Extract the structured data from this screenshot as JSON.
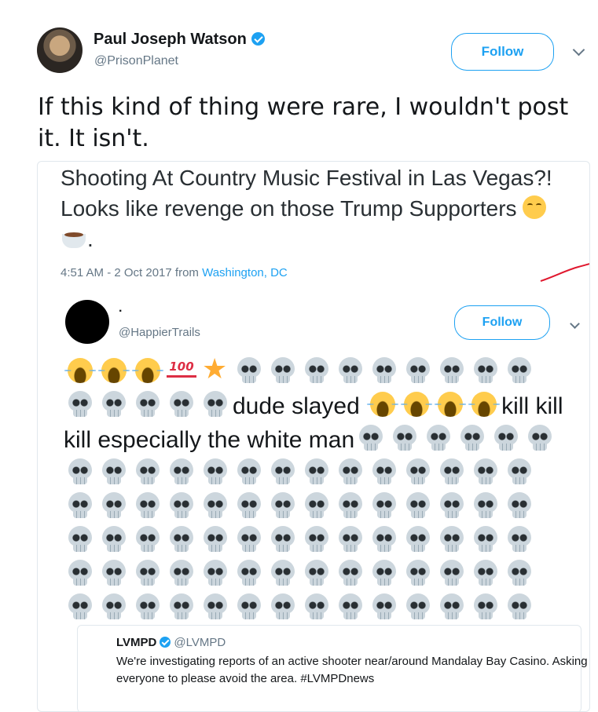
{
  "tweet": {
    "author_name": "Paul Joseph Watson",
    "author_handle": "@PrisonPlanet",
    "follow_label": "Follow",
    "text": "If this kind of thing were rare, I wouldn't post it. It isn't."
  },
  "embedded_screenshot": {
    "text": "Shooting At Country Music Festival in Las Vegas?! Looks like revenge on those Trump Supporters",
    "text_end": ".",
    "meta_time": "4:51 AM - 2 Oct 2017 from ",
    "meta_location": "Washington, DC",
    "emojis": [
      "relieved-face",
      "hot-beverage"
    ],
    "inner_tweet": {
      "author_name": ".",
      "author_handle": "@HappierTrails",
      "follow_label": "Follow",
      "text_words_1": "dude slayed",
      "text_words_2": "kill",
      "text_words_3": "kill kill especially the white man",
      "quoted_tweet": {
        "author_name": "LVMPD",
        "author_handle": "@LVMPD",
        "text": "We're investigating reports of an active shooter near/around Mandalay Bay Casino. Asking everyone to please avoid the area. #LVMPDnews"
      }
    }
  },
  "colors": {
    "accent": "#1da1f2",
    "text": "#14171a",
    "secondary": "#657786",
    "annotation": "#e0182e"
  }
}
